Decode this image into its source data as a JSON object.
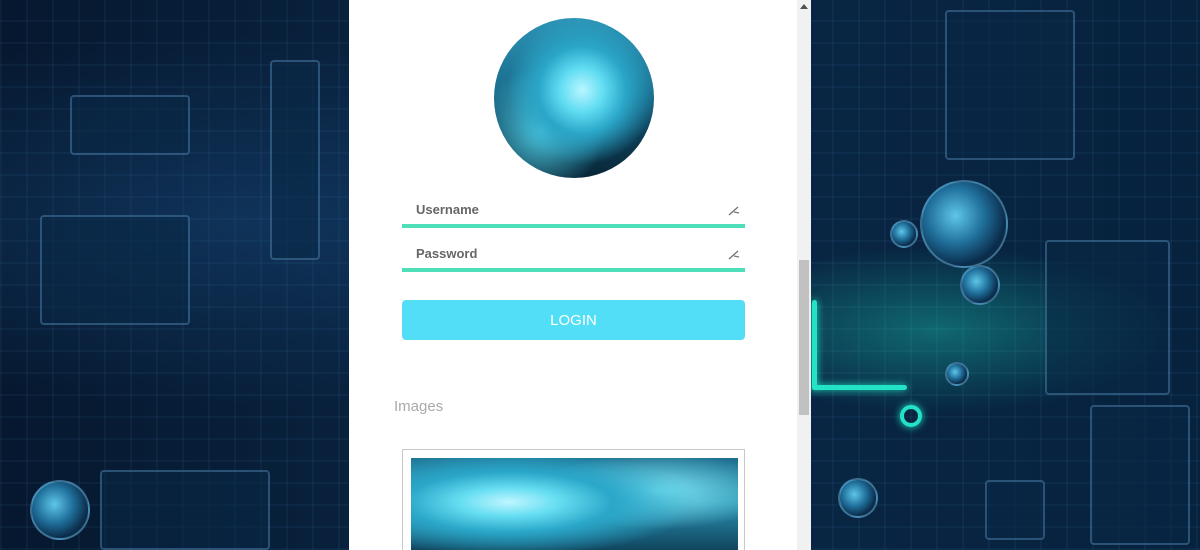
{
  "login_form": {
    "username_label": "Username",
    "password_label": "Password",
    "login_button": "LOGIN"
  },
  "images_section": {
    "title": "Images"
  },
  "colors": {
    "accent": "#4edfba",
    "button": "#52def7"
  },
  "icons": {
    "field_icon": "edit-pen-icon"
  }
}
